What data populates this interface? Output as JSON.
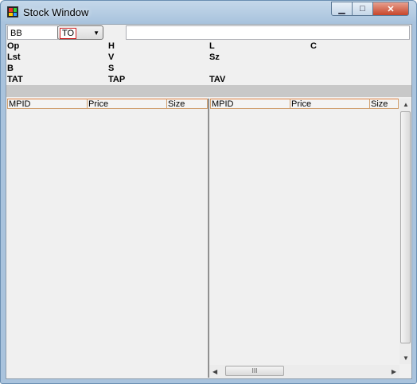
{
  "window": {
    "title": "Stock Window",
    "min": "▁",
    "max": "□",
    "close": "✕"
  },
  "controls": {
    "symbol": "BB",
    "exchange": "TO",
    "exchange_arrow": "▼",
    "message": ""
  },
  "quote_labels": {
    "op": "Op",
    "h": "H",
    "l": "L",
    "c": "C",
    "lst": "Lst",
    "v": "V",
    "sz": "Sz",
    "b": "B",
    "s": "S",
    "tat": "TAT",
    "tap": "TAP",
    "tav": "TAV"
  },
  "bid_table": {
    "columns": [
      "MPID",
      "Price",
      "Size"
    ]
  },
  "ask_table": {
    "columns": [
      "MPID",
      "Price",
      "Size"
    ]
  },
  "scroll": {
    "up": "▲",
    "down": "▼",
    "left": "◀",
    "right": "▶",
    "grip": "III"
  },
  "colors": {
    "header_border": "#e08040",
    "bar": "#c8c8c8",
    "close_button": "#c7452b"
  }
}
